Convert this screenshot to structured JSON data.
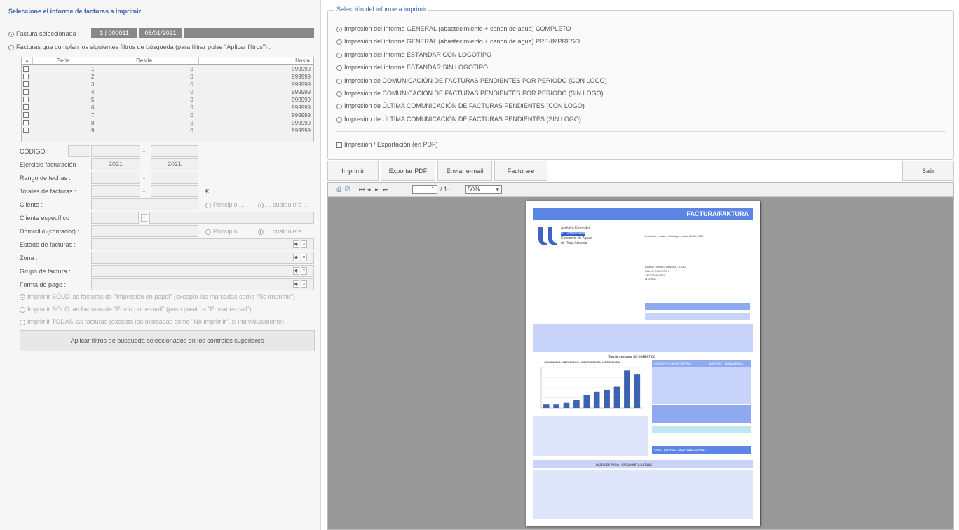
{
  "left": {
    "title": "Seleccione el informe de facturas a imprimir",
    "selected_label": "Factura seleccionada :",
    "selected_invoice": "1 | 000011",
    "selected_date": "08/01/2021",
    "filter_label": "Facturas que cumplan los siguientes filtros de búsqueda (para filtrar pulse \"Aplicar filtros\") :",
    "series_headers": [
      "Serie",
      "Desde",
      "Hasta"
    ],
    "series_rows": [
      {
        "serie": "1",
        "desde": "0",
        "hasta": "999999"
      },
      {
        "serie": "2",
        "desde": "0",
        "hasta": "999999"
      },
      {
        "serie": "3",
        "desde": "0",
        "hasta": "999999"
      },
      {
        "serie": "4",
        "desde": "0",
        "hasta": "999999"
      },
      {
        "serie": "5",
        "desde": "0",
        "hasta": "999999"
      },
      {
        "serie": "6",
        "desde": "0",
        "hasta": "999999"
      },
      {
        "serie": "7",
        "desde": "0",
        "hasta": "999999"
      },
      {
        "serie": "8",
        "desde": "0",
        "hasta": "999999"
      },
      {
        "serie": "9",
        "desde": "0",
        "hasta": "999999"
      }
    ],
    "codigo_label": "CÓDIGO :",
    "ejercicio_label": "Ejercicio facturación :",
    "ejercicio_from": "2021",
    "ejercicio_to": "2021",
    "rango_label": "Rango de fechas :",
    "totales_label": "Totales de facturas :",
    "euro": "€",
    "cliente_label": "Cliente :",
    "principio": "Principio ...",
    "cualquiera": "... cualquiera ...",
    "cliente_especifico_label": "Cliente específico :",
    "domicilio_label": "Domicilio (contador) :",
    "estado_label": "Estado de facturas :",
    "zona_label": "Zona :",
    "grupo_label": "Grupo de factura :",
    "forma_label": "Forma de pago :",
    "imprimir_papel": "Imprimir SÓLO las facturas de \"Impresión en papel\" (excepto las marcadas como \"No imprimir\")",
    "imprimir_email": "Imprimir SÓLO las facturas de \"Envío por e-mail\" (paso previo a \"Enviar e-mail\")",
    "imprimir_todas": "Imprimir TODAS las facturas (excepto las marcadas como \"No imprimir\", si individualmente)",
    "apply_button": "Aplicar filtros de búsqueda seleccionados en los controles superiores"
  },
  "report": {
    "legend": "Selección del informe a imprimir",
    "options": [
      "Impresión del informe GENERAL (abastecimiento + canon de agua) COMPLETO",
      "Impresión del informe GENERAL (abastecimiento + canon de agua) PRE-IMPRESO",
      "Impresión del informe ESTÁNDAR CON LOGOTIPO",
      "Impresión del informe ESTÁNDAR SIN LOGOTIPO",
      "Impresión de COMUNICACIÓN DE FACTURAS PENDIENTES POR PERIODO (CON LOGO)",
      "Impresión de COMUNICACIÓN DE FACTURAS PENDIENTES POR PERIODO (SIN LOGO)",
      "Impresión de ÚLTIMA COMUNICACIÓN DE FACTURAS PENDIENTES (CON LOGO)",
      "Impresión de ÚLTIMA COMUNICACIÓN DE FACTURAS PENDIENTES (SIN LOGO)"
    ],
    "pdf_label": "Impresión / Exportación (en PDF)"
  },
  "actions": {
    "imprimir": "Imprimir",
    "exportar": "Exportar PDF",
    "email": "Enviar e-mail",
    "facturae": "Factura-e",
    "salir": "Salir"
  },
  "viewer": {
    "page_num": "1",
    "page_total": "/ 1+",
    "zoom": "50%"
  },
  "document": {
    "header": "FACTURA/FAKTURA",
    "company_line1": "Arabako Errioxako",
    "company_line2": "Ur Kontsortzioa",
    "company_line3": "Consorcio de Aguas",
    "company_line4": "de Rioja Alavesa",
    "emision": "Fecha de emisión / Jaulkipen data: 08-01-2021",
    "client_line1": "BIMBO DONUTS IBERIA, S.A.U.",
    "client_line2": "CALLE CIGÜEÑA 1",
    "client_line3": "28022 MADRID",
    "client_line4": "MADRID",
    "consumos_title": "CONSUMOS HISTÓRICOS / KONTSUMOEN HISTORIKOA",
    "tipo_consumo": "Tipo de consumo: NO DOMESTICO",
    "concepto": "CONCEPTO / KONTZEPTUA",
    "importe": "IMPORTE / ZENBATEKOA",
    "total": "TOTAL FACTURA / FAKTURA GUZTIRA",
    "pago": "DATOS DE PAGO / ORDAINKETA DATUAK"
  },
  "chart_data": {
    "type": "bar",
    "title": "CONSUMOS HISTÓRICOS / KONTSUMOEN HISTORIKOA",
    "values": [
      4,
      4,
      5,
      8,
      13,
      16,
      18,
      21,
      37,
      33
    ],
    "ylim": [
      0,
      40
    ]
  },
  "colors": {
    "title_blue": "#3c66b0",
    "doc_blue": "#5b86e5",
    "doc_light": "#c7d3f8"
  }
}
